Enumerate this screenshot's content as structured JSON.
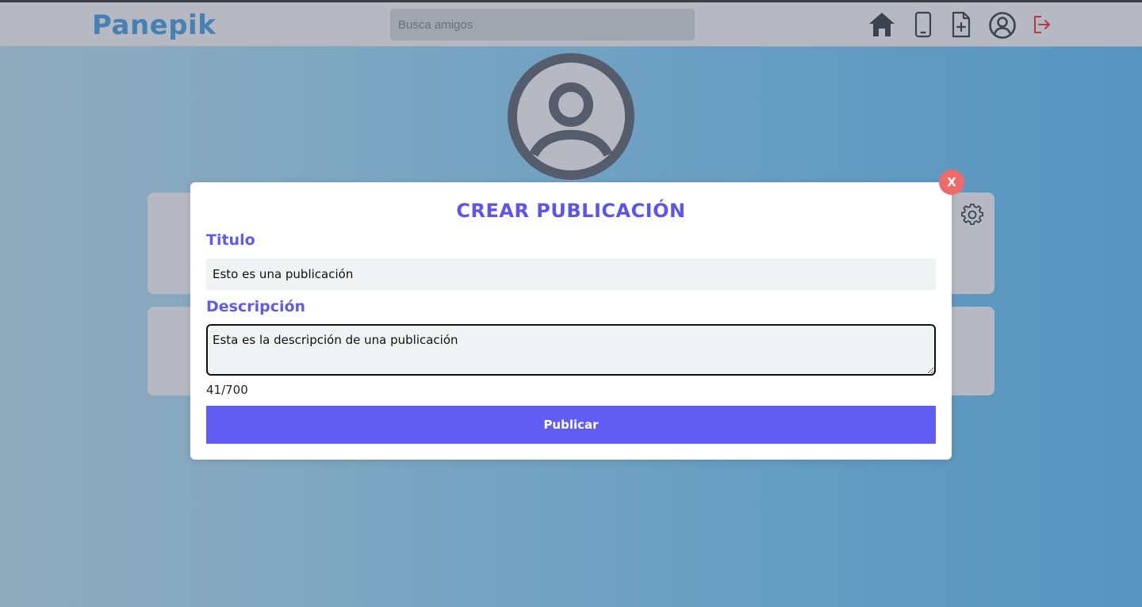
{
  "app": {
    "name": "Panepik"
  },
  "navbar": {
    "search_placeholder": "Busca amigos",
    "icons": [
      "home-icon",
      "phone-icon",
      "add-file-icon",
      "user-circle-icon",
      "logout-icon"
    ]
  },
  "modal": {
    "close_label": "X",
    "title": "CREAR PUBLICACIÓN",
    "title_label": "Titulo",
    "title_value": "Esto es una publicación",
    "description_label": "Descripción",
    "description_value": "Esta es la descripción de una publicación",
    "counter": "41/700",
    "publish_label": "Publicar"
  },
  "colors": {
    "logo": "#4681b3",
    "accent": "#615cf2",
    "close": "#f06a6a",
    "logout": "#b23b4a"
  }
}
